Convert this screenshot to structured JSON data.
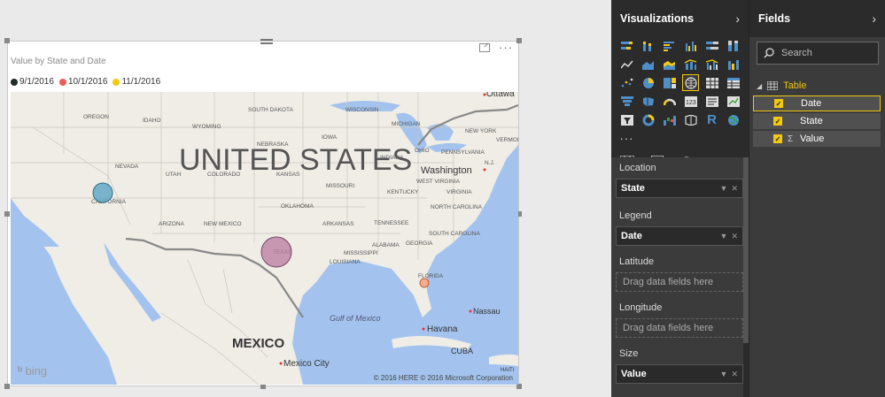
{
  "visual": {
    "title": "Value by State and Date",
    "legend": [
      {
        "label": "9/1/2016",
        "color": "#1f2d2a"
      },
      {
        "label": "10/1/2016",
        "color": "#ef5b5b"
      },
      {
        "label": "11/1/2016",
        "color": "#f2c811"
      }
    ],
    "map_labels": {
      "country_us": "UNITED STATES",
      "country_mx": "MEXICO",
      "gulf": "Gulf of Mexico",
      "washington": "Washington",
      "mexico_city": "Mexico City",
      "havana": "Havana",
      "cuba": "CUBA",
      "nassau": "Nassau",
      "ottawa": "Ottawa",
      "haiti": "HAITI",
      "states": [
        "OREGON",
        "IDAHO",
        "WYOMING",
        "SOUTH DAKOTA",
        "WISCONSIN",
        "MICHIGAN",
        "NEW YORK",
        "NEBRASKA",
        "IOWA",
        "OHIO",
        "PENNSYLVANIA",
        "N.J.",
        "NEVADA",
        "UTAH",
        "COLORADO",
        "KANSAS",
        "MISSOURI",
        "INDIANA",
        "WEST VIRGINIA",
        "KENTUCKY",
        "VIRGINIA",
        "CALIFORNIA",
        "OKLAHOMA",
        "TENNESSEE",
        "NORTH CAROLINA",
        "ARIZONA",
        "NEW MEXICO",
        "ARKANSAS",
        "SOUTH CAROLINA",
        "ALABAMA",
        "GEORGIA",
        "MISSISSIPPI",
        "TEXAS",
        "LOUISIANA",
        "FLORIDA",
        "VERMONT"
      ]
    },
    "bubbles": [
      {
        "state": "California",
        "color": "#5ba3c4"
      },
      {
        "state": "Texas",
        "color": "#b97aa0"
      },
      {
        "state": "Florida",
        "color": "#f4a582"
      }
    ],
    "bing_label": "bing",
    "copyright": "© 2016 HERE   © 2016 Microsoft Corporation"
  },
  "visualizations": {
    "title": "Visualizations",
    "icons": [
      "stacked-bar-icon",
      "stacked-column-icon",
      "clustered-bar-icon",
      "clustered-column-icon",
      "100-bar-icon",
      "100-column-icon",
      "line-chart-icon",
      "area-chart-icon",
      "stacked-area-icon",
      "line-column-icon",
      "line-clustered-icon",
      "ribbon-icon",
      "scatter-icon",
      "pie-icon",
      "treemap-icon",
      "map-icon",
      "table-icon",
      "matrix-icon",
      "funnel-icon",
      "filled-map-icon",
      "gauge-icon",
      "card-icon",
      "multirow-card-icon",
      "kpi-icon",
      "slicer-icon",
      "donut-icon",
      "waterfall-icon",
      "shape-map-icon",
      "r-visual-icon",
      "globe-icon",
      "more-icon"
    ],
    "wells": {
      "location_label": "Location",
      "location_value": "State",
      "legend_label": "Legend",
      "legend_value": "Date",
      "latitude_label": "Latitude",
      "latitude_placeholder": "Drag data fields here",
      "longitude_label": "Longitude",
      "longitude_placeholder": "Drag data fields here",
      "size_label": "Size",
      "size_value": "Value"
    }
  },
  "fields": {
    "title": "Fields",
    "search_placeholder": "Search",
    "table_name": "Table",
    "items": [
      {
        "name": "Date",
        "checked": true
      },
      {
        "name": "State",
        "checked": true
      },
      {
        "name": "Value",
        "checked": true,
        "sigma": "Σ"
      }
    ]
  }
}
